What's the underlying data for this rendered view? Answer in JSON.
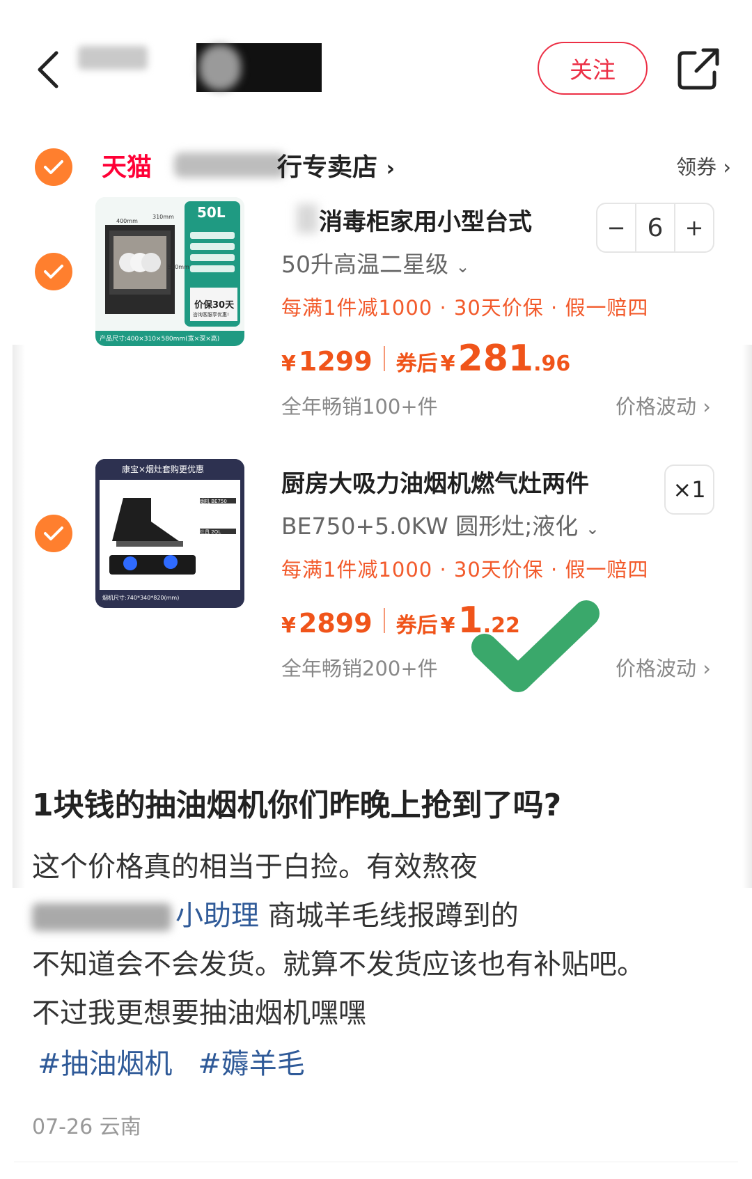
{
  "header": {
    "follow_label": "关注"
  },
  "shop": {
    "brand": "天猫",
    "name_visible": "行专卖店",
    "coupon_label": "领券"
  },
  "products": [
    {
      "title": "消毒柜家用小型台式",
      "spec": "50升高温二星级",
      "promo": "每满1件减1000 · 30天价保 · 假一赔四",
      "price_original": "1299",
      "price_after_label": "券后",
      "price_after_int": "281",
      "price_after_dec": ".96",
      "sales": "全年畅销100+件",
      "trend_label": "价格波动",
      "quantity": "6",
      "qty_minus": "−",
      "qty_plus": "+",
      "thumb": {
        "capacity": "50L",
        "dim_w": "400mm",
        "dim_d": "310mm",
        "dim_h": "580mm",
        "badge": "价保30天",
        "badge_sub": "咨询客服享优惠!",
        "footer": "产品尺寸:400×310×580mm(宽×深×高)"
      }
    },
    {
      "title": "厨房大吸力油烟机燃气灶两件",
      "spec": "BE750+5.0KW 圆形灶;液化",
      "promo": "每满1件减1000 · 30天价保 · 假一赔四",
      "price_original": "2899",
      "price_after_label": "券后",
      "price_after_int": "1",
      "price_after_dec": ".22",
      "sales": "全年畅销200+件",
      "trend_label": "价格波动",
      "quantity": "×1",
      "thumb": {
        "banner": "康宝×烟灶套购更优惠",
        "hood_model": "烟机 BE750",
        "stove_model": "灶具 2QL",
        "footer": "烟机尺寸:740*340*820(mm)"
      }
    }
  ],
  "post": {
    "title": "1块钱的抽油烟机你们昨晚上抢到了吗?",
    "line1": "这个价格真的相当于白捡。有效熬夜",
    "line2_link": "小助理",
    "line2_rest": " 商城羊毛线报蹲到的",
    "line3": "不知道会不会发货。就算不发货应该也有补贴吧。",
    "line4": "不过我更想要抽油烟机嘿嘿",
    "tags": [
      "#抽油烟机",
      "#薅羊毛"
    ],
    "date": "07-26",
    "location": "云南"
  },
  "colors": {
    "accent_red": "#ec2f45",
    "price_orange": "#f0541a",
    "checkbox_orange": "#ff7f2e",
    "link_blue": "#2f5a98",
    "check_green": "#3aa86b"
  }
}
